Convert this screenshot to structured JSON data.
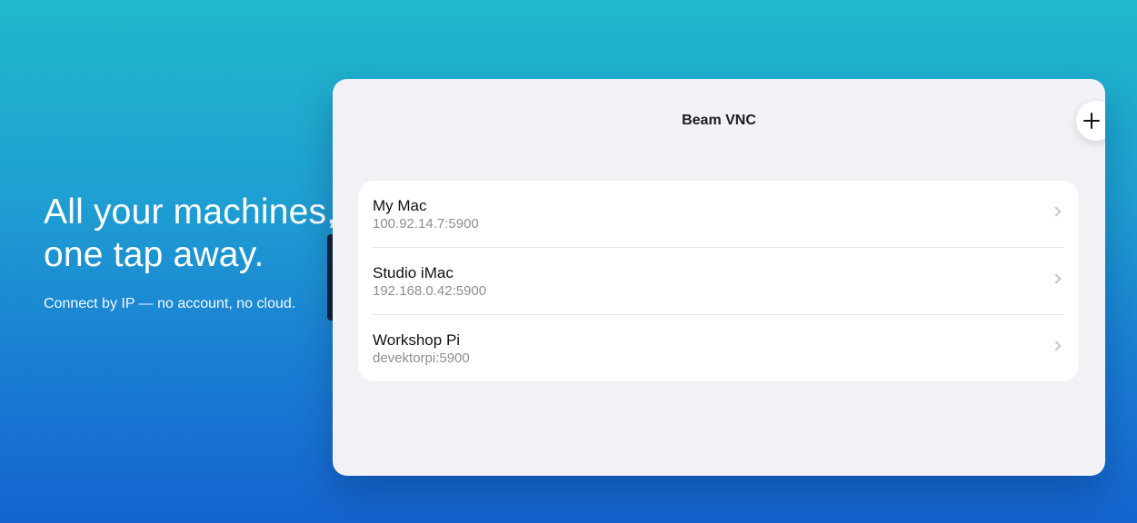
{
  "hero": {
    "title_line_1": "All your machines,",
    "title_line_2": "one tap away.",
    "subtitle": "Connect by IP — no account, no cloud."
  },
  "app": {
    "title": "Beam VNC",
    "add_button_icon": "plus-icon"
  },
  "machines": [
    {
      "name": "My Mac",
      "address": "100.92.14.7:5900",
      "icon": "chevron-right-icon"
    },
    {
      "name": "Studio iMac",
      "address": "192.168.0.42:5900",
      "icon": "chevron-right-icon"
    },
    {
      "name": "Workshop Pi",
      "address": "devektorpi:5900",
      "icon": "chevron-right-icon"
    }
  ],
  "colors": {
    "background_top": "#20b9cb",
    "background_bottom": "#1463cf",
    "window_background": "#f1f1f6",
    "list_background": "#ffffff",
    "secondary_text": "#8e8e93",
    "chevron": "#c7c7cc"
  }
}
